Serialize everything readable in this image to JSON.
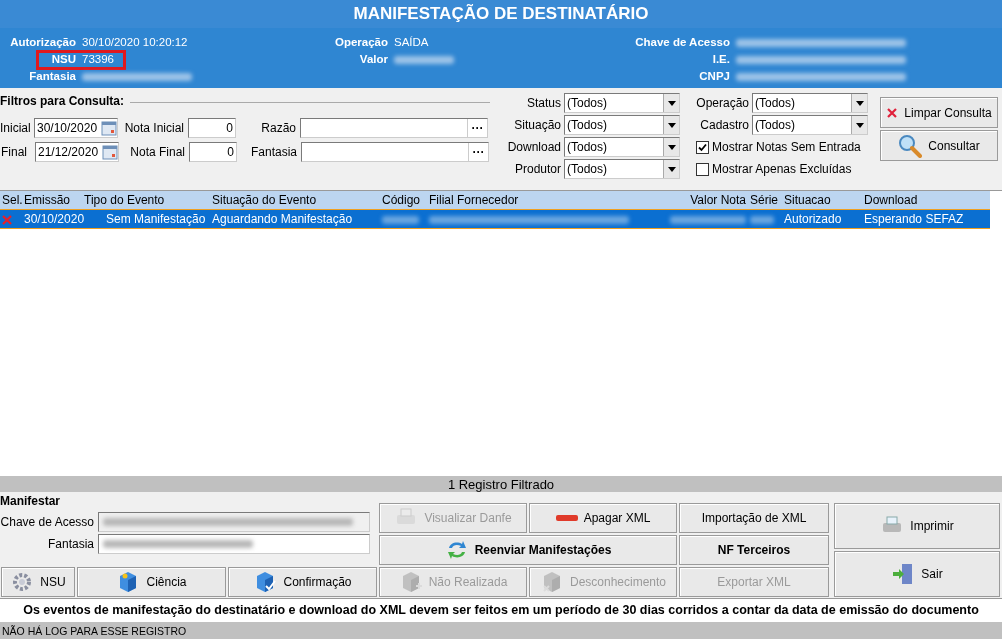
{
  "window": {
    "title": "MANIFESTAÇÃO DE DESTINATÁRIO"
  },
  "header": {
    "columns": [
      [
        {
          "label": "Autorização",
          "value": "30/10/2020 10:20:12"
        },
        {
          "label": "NSU",
          "value": "73396",
          "highlighted": true
        },
        {
          "label": "Fantasia",
          "blurred": true
        }
      ],
      [
        {
          "label": "Operação",
          "value": "SAÍDA"
        },
        {
          "label": "Valor",
          "blurred": true
        }
      ],
      [
        {
          "label": "Chave de Acesso",
          "blurred": true
        },
        {
          "label": "I.E.",
          "blurred": true
        },
        {
          "label": "CNPJ",
          "blurred": true
        }
      ]
    ]
  },
  "filters": {
    "title": "Filtros para Consulta:",
    "dates": [
      {
        "label": "Inicial",
        "value": "30/10/2020"
      },
      {
        "label": "Final",
        "value": "21/12/2020"
      }
    ],
    "numbers": [
      {
        "label": "Nota Inicial",
        "value": "0"
      },
      {
        "label": "Nota Final",
        "value": "0"
      }
    ],
    "lookups": [
      {
        "label": "Razão",
        "button": "···"
      },
      {
        "label": "Fantasia",
        "button": "···"
      }
    ],
    "selects": [
      {
        "label": "Status",
        "value": "(Todos)"
      },
      {
        "label": "Situação",
        "value": "(Todos)"
      },
      {
        "label": "Download",
        "value": "(Todos)"
      },
      {
        "label": "Produtor",
        "value": "(Todos)"
      }
    ],
    "selects_2": [
      {
        "label": "Operação",
        "value": "(Todos)"
      },
      {
        "label": "Cadastro",
        "value": "(Todos)"
      }
    ],
    "checkboxes": [
      {
        "label": "Mostrar Notas Sem Entrada",
        "checked": true
      },
      {
        "label": "Mostrar Apenas Excluídas",
        "checked": false
      }
    ],
    "buttons": [
      {
        "label": "Limpar Consulta"
      },
      {
        "label": "Consultar"
      }
    ]
  },
  "table": {
    "columns": [
      "Sel.",
      "Emissão",
      "Tipo do Evento",
      "Situação do Evento",
      "Código",
      "Filial Fornecedor",
      "Valor Nota",
      "Série",
      "Situacao",
      "Download"
    ],
    "rows": [
      {
        "selected": true,
        "cells": [
          {
            "kind": "mark"
          },
          {
            "text": "30/10/2020"
          },
          {
            "text": "Sem Manifestação"
          },
          {
            "text": "Aguardando Manifestação"
          },
          {
            "blurred": true
          },
          {
            "blurred": true
          },
          {
            "blurred": true
          },
          {
            "blurred": true
          },
          {
            "text": "Autorizado"
          },
          {
            "text": "Esperando SEFAZ"
          }
        ]
      }
    ]
  },
  "status_bar": "1 Registro Filtrado",
  "manifest": {
    "title": "Manifestar",
    "fields": [
      {
        "label": "Chave de Acesso",
        "blurred": true,
        "disabled": true
      },
      {
        "label": "Fantasia",
        "blurred": true,
        "disabled": false
      }
    ]
  },
  "actions": [
    {
      "label": "Visualizar Danfe",
      "disabled": true
    },
    {
      "label": "Apagar XML",
      "disabled": false
    },
    {
      "label": "Importação de XML",
      "disabled": false
    },
    {
      "label": "Imprimir",
      "disabled": false
    },
    {
      "label": "Reenviar Manifestações",
      "disabled": false
    },
    {
      "label": "NF Terceiros",
      "disabled": false
    },
    {
      "label": "Sair",
      "disabled": false
    },
    {
      "label": "NSU",
      "disabled": false
    },
    {
      "label": "Ciência",
      "disabled": false
    },
    {
      "label": "Confirmação",
      "disabled": false
    },
    {
      "label": "Não Realizada",
      "disabled": true
    },
    {
      "label": "Desconhecimento",
      "disabled": true
    },
    {
      "label": "Exportar XML",
      "disabled": true
    }
  ],
  "notice": "Os eventos de manifestação do destinatário e download do XML devem ser feitos em um período de 30 dias corridos a contar da data de emissão do documento",
  "log": "NÃO HÁ LOG PARA ESSE REGISTRO"
}
